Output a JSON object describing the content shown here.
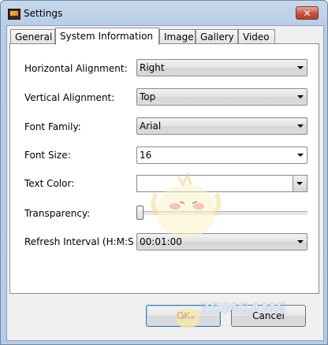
{
  "window": {
    "title": "Settings",
    "close_glyph": "✕"
  },
  "tabs": [
    "General",
    "System Information",
    "Image",
    "Gallery",
    "Video"
  ],
  "active_tab": "System Information",
  "fields": {
    "horizontal_alignment": {
      "label": "Horizontal Alignment:",
      "value": "Right"
    },
    "vertical_alignment": {
      "label": "Vertical Alignment:",
      "value": "Top"
    },
    "font_family": {
      "label": "Font Family:",
      "value": "Arial"
    },
    "font_size": {
      "label": "Font Size:",
      "value": "16"
    },
    "text_color": {
      "label": "Text Color:"
    },
    "transparency": {
      "label": "Transparency:",
      "level": 0
    },
    "refresh_interval": {
      "label": "Refresh Interval (H:M:S",
      "value": "00:01:00"
    }
  },
  "buttons": {
    "ok": "OK",
    "cancel": "Cancel"
  },
  "watermark": {
    "text": "3DMGAME"
  },
  "icons": {
    "app": "settings-app-icon",
    "close": "close-icon",
    "dropdown": "chevron-down-icon"
  }
}
